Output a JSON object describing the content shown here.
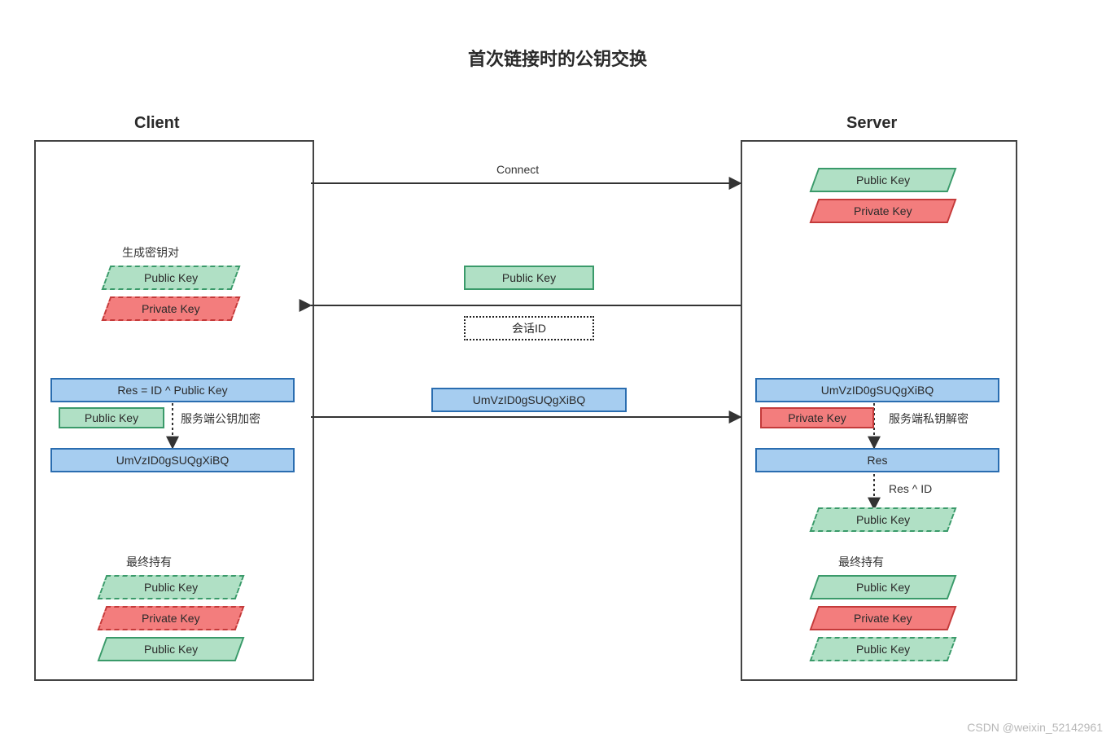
{
  "title": "首次链接时的公钥交换",
  "client_label": "Client",
  "server_label": "Server",
  "arrows": {
    "connect": "Connect",
    "public_key": "Public Key",
    "session_id": "会话ID",
    "cipher": "UmVzID0gSUQgXiBQ"
  },
  "client": {
    "gen_pair_label": "生成密钥对",
    "pub": "Public Key",
    "priv": "Private Key",
    "calc_res": "Res = ID ^ Public Key",
    "enc_pub": "Public Key",
    "enc_label": "服务端公钥加密",
    "cipher": "UmVzID0gSUQgXiBQ",
    "final_label": "最终持有",
    "final_pub1": "Public Key",
    "final_priv": "Private Key",
    "final_pub2": "Public Key"
  },
  "server": {
    "pub": "Public Key",
    "priv": "Private Key",
    "cipher": "UmVzID0gSUQgXiBQ",
    "dec_priv": "Private Key",
    "dec_label": "服务端私钥解密",
    "res": "Res",
    "xor_label": "Res ^ ID",
    "derived_pub": "Public Key",
    "final_label": "最终持有",
    "final_pub1": "Public Key",
    "final_priv": "Private Key",
    "final_pub2": "Public Key"
  },
  "watermark": "CSDN @weixin_52142961"
}
